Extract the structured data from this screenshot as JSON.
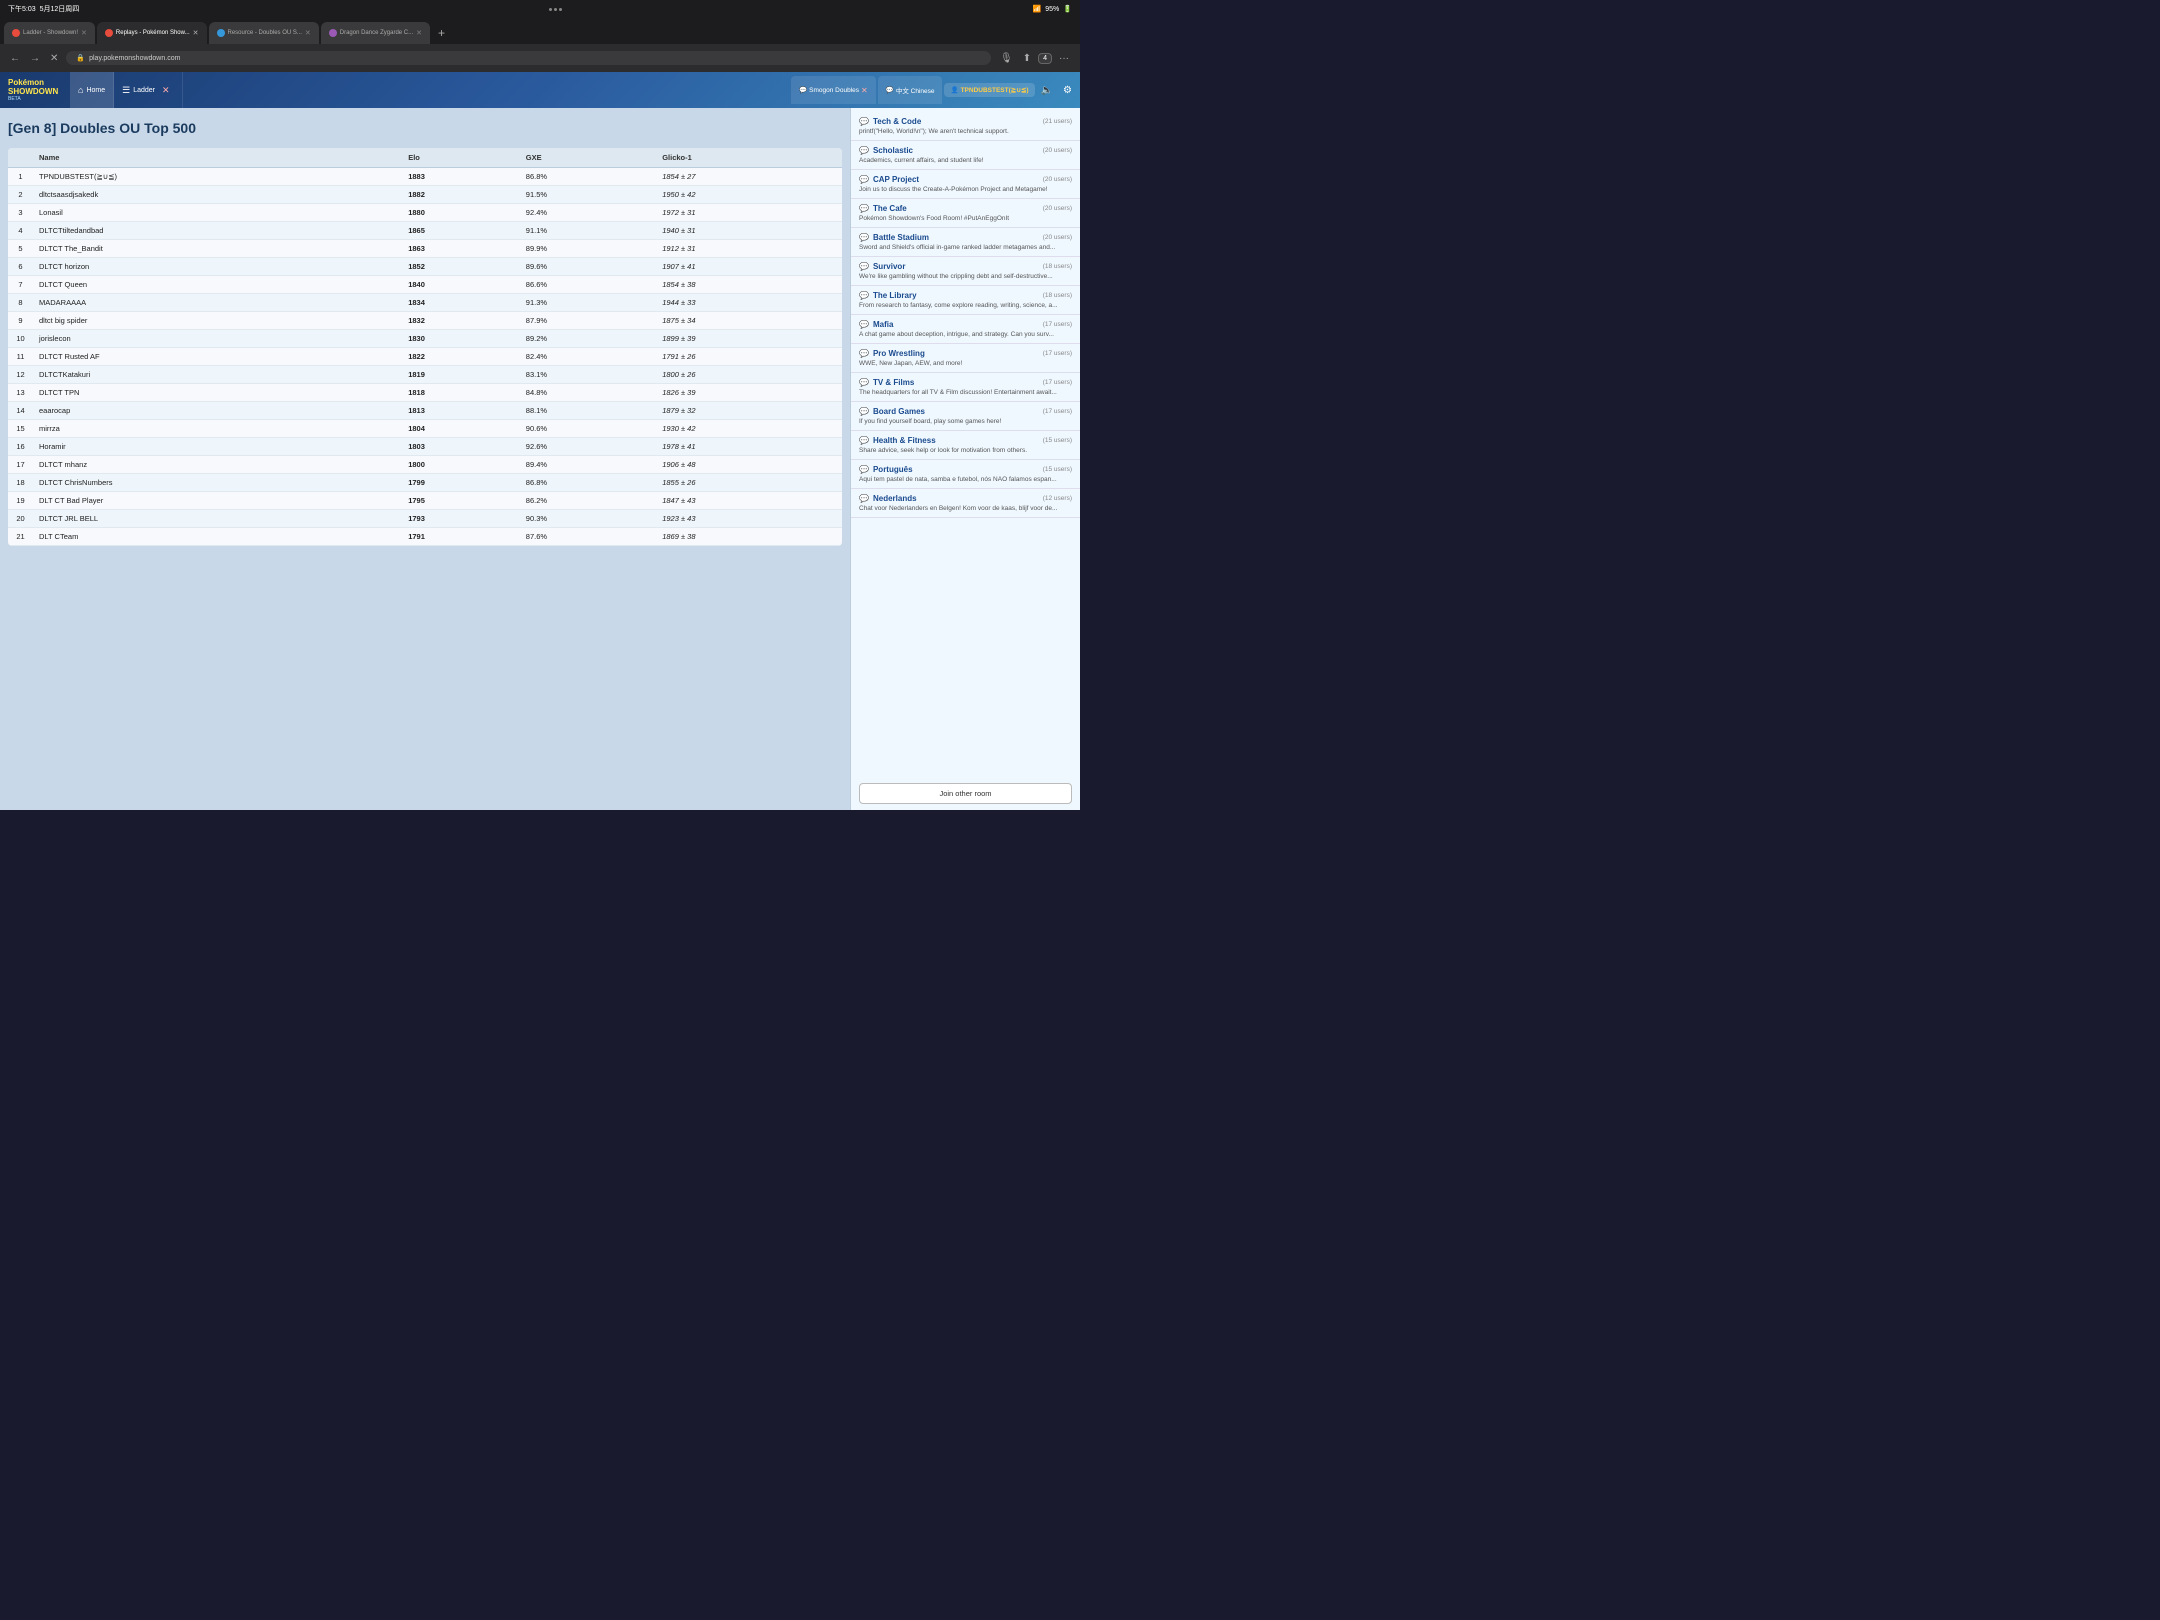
{
  "statusBar": {
    "time": "下午5:03",
    "date": "5月12日周四",
    "wifi": "WiFi",
    "battery": "95%"
  },
  "tabs": [
    {
      "id": "tab1",
      "label": "Ladder - Showdown!",
      "icon": "pokeball",
      "active": false
    },
    {
      "id": "tab2",
      "label": "Replays - Pokémon Show...",
      "icon": "pokeball",
      "active": true
    },
    {
      "id": "tab3",
      "label": "Resource - Doubles OU S...",
      "icon": "resource",
      "active": false
    },
    {
      "id": "tab4",
      "label": "Dragon Dance Zygarde C...",
      "icon": "dragon",
      "active": false
    }
  ],
  "addressBar": {
    "url": "play.pokemonshowdown.com"
  },
  "tabCount": "4",
  "header": {
    "home": "Home",
    "ladder": "Ladder",
    "smogonDoubles": "Smogon Doubles",
    "chinese": "中文 Chinese",
    "user": "TPNDUBSTEST(≧∪≦)"
  },
  "pageTitle": "[Gen 8] Doubles OU Top 500",
  "table": {
    "headers": [
      "",
      "Name",
      "Elo",
      "GXE",
      "Glicko-1"
    ],
    "rows": [
      {
        "rank": 1,
        "name": "TPNDUBSTEST(≧∪≦)",
        "elo": "1883",
        "gxe": "86.8%",
        "glicko": "1854 ± 27"
      },
      {
        "rank": 2,
        "name": "dltctsaasdjsakedk",
        "elo": "1882",
        "gxe": "91.5%",
        "glicko": "1950 ± 42"
      },
      {
        "rank": 3,
        "name": "Lonasil",
        "elo": "1880",
        "gxe": "92.4%",
        "glicko": "1972 ± 31"
      },
      {
        "rank": 4,
        "name": "DLTCTtiltedandbad",
        "elo": "1865",
        "gxe": "91.1%",
        "glicko": "1940 ± 31"
      },
      {
        "rank": 5,
        "name": "DLTCT The_Bandit",
        "elo": "1863",
        "gxe": "89.9%",
        "glicko": "1912 ± 31"
      },
      {
        "rank": 6,
        "name": "DLTCT horizon",
        "elo": "1852",
        "gxe": "89.6%",
        "glicko": "1907 ± 41"
      },
      {
        "rank": 7,
        "name": "DLTCT Queen",
        "elo": "1840",
        "gxe": "86.6%",
        "glicko": "1854 ± 38"
      },
      {
        "rank": 8,
        "name": "MADARAAAA",
        "elo": "1834",
        "gxe": "91.3%",
        "glicko": "1944 ± 33"
      },
      {
        "rank": 9,
        "name": "dltct big spider",
        "elo": "1832",
        "gxe": "87.9%",
        "glicko": "1875 ± 34"
      },
      {
        "rank": 10,
        "name": "jorislecon",
        "elo": "1830",
        "gxe": "89.2%",
        "glicko": "1899 ± 39"
      },
      {
        "rank": 11,
        "name": "DLTCT Rusted AF",
        "elo": "1822",
        "gxe": "82.4%",
        "glicko": "1791 ± 26"
      },
      {
        "rank": 12,
        "name": "DLTCTKatakuri",
        "elo": "1819",
        "gxe": "83.1%",
        "glicko": "1800 ± 26"
      },
      {
        "rank": 13,
        "name": "DLTCT TPN",
        "elo": "1818",
        "gxe": "84.8%",
        "glicko": "1826 ± 39"
      },
      {
        "rank": 14,
        "name": "eaarocap",
        "elo": "1813",
        "gxe": "88.1%",
        "glicko": "1879 ± 32"
      },
      {
        "rank": 15,
        "name": "mirrza",
        "elo": "1804",
        "gxe": "90.6%",
        "glicko": "1930 ± 42"
      },
      {
        "rank": 16,
        "name": "Horamir",
        "elo": "1803",
        "gxe": "92.6%",
        "glicko": "1978 ± 41"
      },
      {
        "rank": 17,
        "name": "DLTCT mhanz",
        "elo": "1800",
        "gxe": "89.4%",
        "glicko": "1906 ± 48"
      },
      {
        "rank": 18,
        "name": "DLTCT ChrisNumbers",
        "elo": "1799",
        "gxe": "86.8%",
        "glicko": "1855 ± 26"
      },
      {
        "rank": 19,
        "name": "DLT CT Bad Player",
        "elo": "1795",
        "gxe": "86.2%",
        "glicko": "1847 ± 43"
      },
      {
        "rank": 20,
        "name": "DLTCT JRL BELL",
        "elo": "1793",
        "gxe": "90.3%",
        "glicko": "1923 ± 43"
      },
      {
        "rank": 21,
        "name": "DLT CTeam",
        "elo": "1791",
        "gxe": "87.6%",
        "glicko": "1869 ± 38"
      }
    ]
  },
  "rooms": [
    {
      "name": "Tech & Code",
      "users": "(21 users)",
      "desc": "printf(\"Hello, World!\\n\"); We aren't technical support."
    },
    {
      "name": "Scholastic",
      "users": "(20 users)",
      "desc": "Academics, current affairs, and student life!"
    },
    {
      "name": "CAP Project",
      "users": "(20 users)",
      "desc": "Join us to discuss the Create-A-Pokémon Project and Metagame!"
    },
    {
      "name": "The Cafe",
      "users": "(20 users)",
      "desc": "Pokémon Showdown's Food Room! #PutAnEggOnIt"
    },
    {
      "name": "Battle Stadium",
      "users": "(20 users)",
      "desc": "Sword and Shield's official in-game ranked ladder metagames and..."
    },
    {
      "name": "Survivor",
      "users": "(18 users)",
      "desc": "We're like gambling without the crippling debt and self-destructive..."
    },
    {
      "name": "The Library",
      "users": "(18 users)",
      "desc": "From research to fantasy, come explore reading, writing, science, a..."
    },
    {
      "name": "Mafia",
      "users": "(17 users)",
      "desc": "A chat game about deception, intrigue, and strategy. Can you surv..."
    },
    {
      "name": "Pro Wrestling",
      "users": "(17 users)",
      "desc": "WWE, New Japan, AEW, and more!"
    },
    {
      "name": "TV & Films",
      "users": "(17 users)",
      "desc": "The headquarters for all TV & Film discussion! Entertainment await..."
    },
    {
      "name": "Board Games",
      "users": "(17 users)",
      "desc": "If you find yourself board, play some games here!"
    },
    {
      "name": "Health & Fitness",
      "users": "(15 users)",
      "desc": "Share advice, seek help or look for motivation from others."
    },
    {
      "name": "Português",
      "users": "(15 users)",
      "desc": "Aqui tem pastel de nata, samba e futebol, nós NÃO falamos espan..."
    },
    {
      "name": "Nederlands",
      "users": "(12 users)",
      "desc": "Chat voor Nederlanders en Belgen! Kom voor de kaas, blijf voor de..."
    }
  ],
  "joinOtherRoom": "Join other room"
}
